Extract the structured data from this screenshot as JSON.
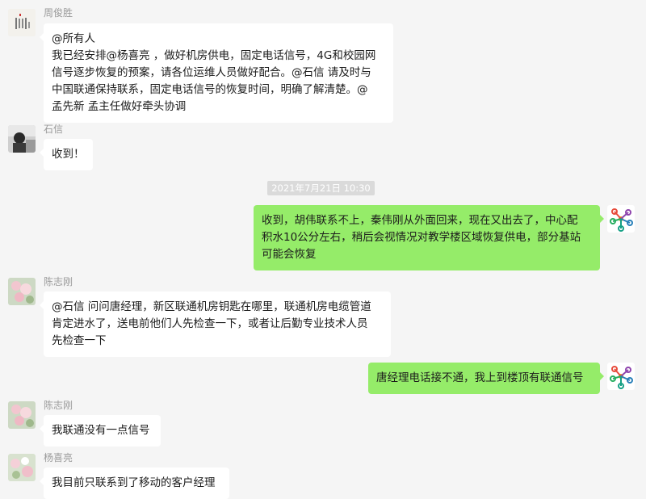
{
  "messages": [
    {
      "sender": "周俊胜",
      "lines": [
        "@所有人",
        "我已经安排@杨喜亮 ，做好机房供电，固定电话信号，4G和校园网",
        "信号逐步恢复的预案，请各位运维人员做好配合。@石信 请及时与",
        "中国联通保持联系，固定电话信号的恢复时间，明确了解清楚。@",
        "孟先新 孟主任做好牵头协调"
      ]
    },
    {
      "sender": "石信",
      "lines": [
        "收到！"
      ]
    },
    {
      "sender": "",
      "lines": [
        "收到，胡伟联系不上，秦伟刚从外面回来，现在又出去了，中心配",
        "积水10公分左右，稍后会视情况对教学楼区域恢复供电，部分基站",
        "可能会恢复"
      ]
    },
    {
      "sender": "陈志刚",
      "lines": [
        "@石信 问问唐经理，新区联通机房钥匙在哪里，联通机房电缆管道",
        "肯定进水了，送电前他们人先检查一下，或者让后勤专业技术人员",
        "先检查一下"
      ]
    },
    {
      "sender": "",
      "lines": [
        "唐经理电话接不通，我上到楼顶有联通信号"
      ]
    },
    {
      "sender": "陈志刚",
      "lines": [
        "我联通没有一点信号"
      ]
    },
    {
      "sender": "杨喜亮",
      "lines": [
        "我目前只联系到了移动的客户经理"
      ]
    }
  ],
  "timestamp": "2021年7月21日 10:30",
  "colors": {
    "background": "#f5f5f5",
    "incoming": "#ffffff",
    "outgoing": "#95ec69",
    "timestamp_bg": "#dadada"
  },
  "icons": {
    "avatar_1": "avatar-calligraphy-icon",
    "avatar_2": "avatar-portrait-icon",
    "avatar_self": "avatar-molecule-logo-icon",
    "avatar_3": "avatar-flower-icon",
    "avatar_4": "avatar-flower-icon"
  }
}
